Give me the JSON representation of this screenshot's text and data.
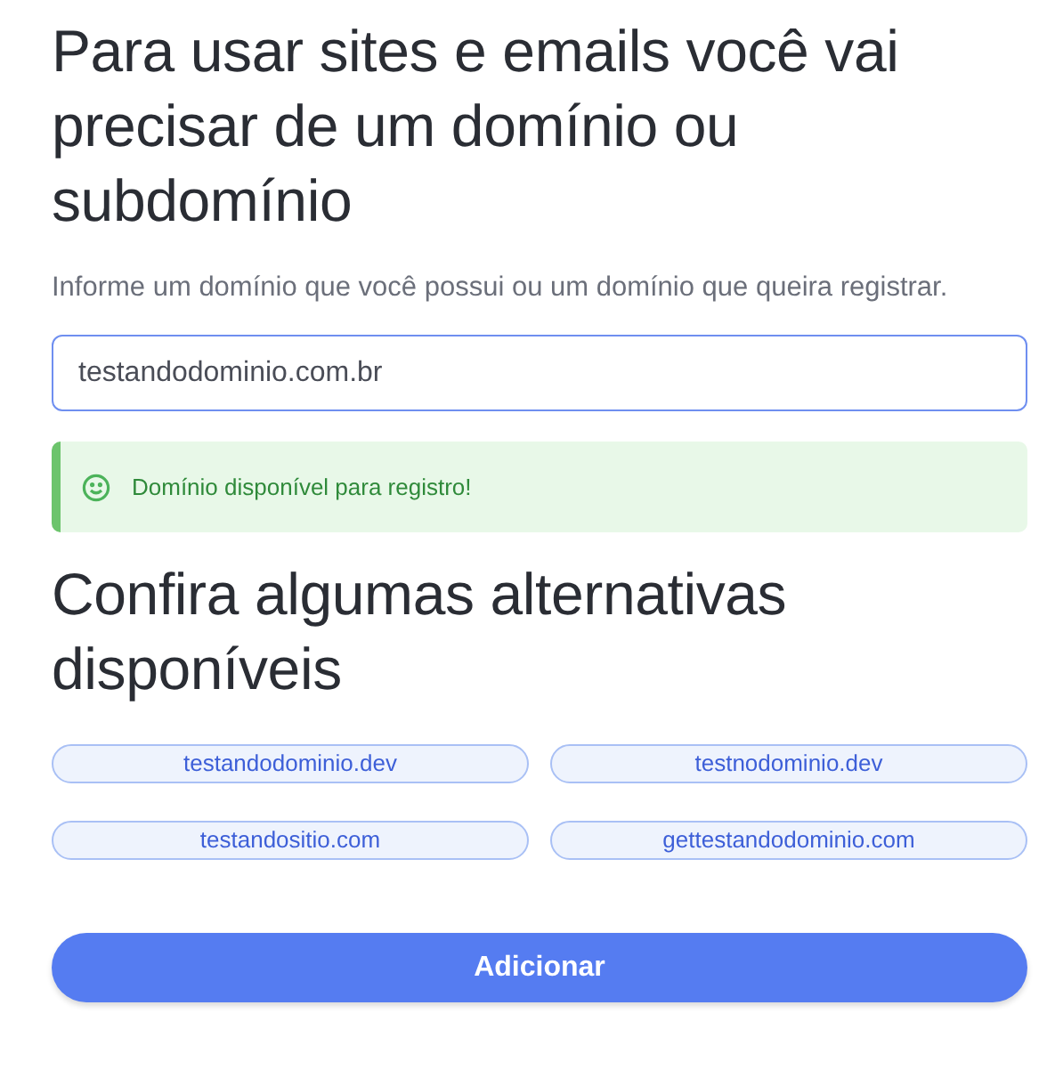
{
  "title": "Para usar sites e emails você vai precisar de um domínio ou subdomínio",
  "description": "Informe um domínio que você possui ou um domínio que queira registrar.",
  "domain_field": {
    "value": "testandodominio.com.br"
  },
  "alert": {
    "kind": "success",
    "text": "Domínio disponível para registro!"
  },
  "alternatives_title": "Confira algumas alternativas disponíveis",
  "alternatives": [
    {
      "label": "testandodominio.dev"
    },
    {
      "label": "testnodominio.dev"
    },
    {
      "label": "testandositio.com"
    },
    {
      "label": "gettestandodominio.com"
    }
  ],
  "submit_button": "Adicionar"
}
